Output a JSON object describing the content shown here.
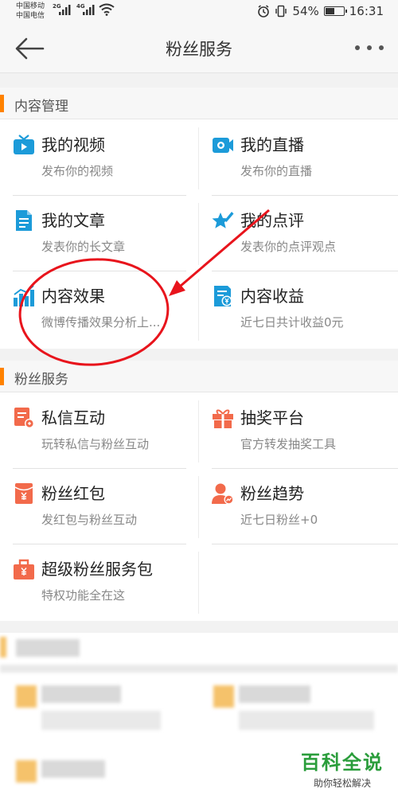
{
  "status_bar": {
    "carrier1": "中国移动",
    "carrier2": "中国电信",
    "net1": "2G",
    "net2": "4G",
    "battery": "54%",
    "battery_level": 0.54,
    "time": "16:31",
    "icons": [
      "signal-icon",
      "wifi-icon",
      "alarm-icon",
      "vibrate-icon",
      "battery-icon"
    ]
  },
  "header": {
    "title": "粉丝服务",
    "back_icon": "back-arrow-icon",
    "more_icon": "more-icon"
  },
  "content_management": {
    "heading": "内容管理",
    "items": [
      {
        "title": "我的视频",
        "subtitle": "发布你的视频",
        "icon": "video-icon",
        "color": "#1c9bd9"
      },
      {
        "title": "我的直播",
        "subtitle": "发布你的直播",
        "icon": "live-camera-icon",
        "color": "#1c9bd9"
      },
      {
        "title": "我的文章",
        "subtitle": "发表你的长文章",
        "icon": "article-icon",
        "color": "#1c9bd9"
      },
      {
        "title": "我的点评",
        "subtitle": "发表你的点评观点",
        "icon": "review-star-icon",
        "color": "#1c9bd9"
      },
      {
        "title": "内容效果",
        "subtitle": "微博传播效果分析上...",
        "icon": "chart-icon",
        "color": "#1c9bd9"
      },
      {
        "title": "内容收益",
        "subtitle": "近七日共计收益0元",
        "icon": "income-icon",
        "color": "#1c9bd9"
      }
    ]
  },
  "fan_service": {
    "heading": "粉丝服务",
    "items": [
      {
        "title": "私信互动",
        "subtitle": "玩转私信与粉丝互动",
        "icon": "message-icon",
        "color": "#f26a4b"
      },
      {
        "title": "抽奖平台",
        "subtitle": "官方转发抽奖工具",
        "icon": "gift-icon",
        "color": "#f26a4b"
      },
      {
        "title": "粉丝红包",
        "subtitle": "发红包与粉丝互动",
        "icon": "red-packet-icon",
        "color": "#f26a4b"
      },
      {
        "title": "粉丝趋势",
        "subtitle": "近七日粉丝+0",
        "icon": "fan-trend-icon",
        "color": "#f26a4b"
      },
      {
        "title": "超级粉丝服务包",
        "subtitle": "特权功能全在这",
        "icon": "service-pack-icon",
        "color": "#f26a4b"
      }
    ]
  },
  "watermark": {
    "title": "百科全说",
    "subtitle": "助你轻松解决"
  },
  "colors": {
    "accent": "#ff8200",
    "blue_icon": "#1c9bd9",
    "orange_icon": "#f26a4b",
    "annotation": "#e8141c",
    "watermark": "#2a9d3b"
  }
}
